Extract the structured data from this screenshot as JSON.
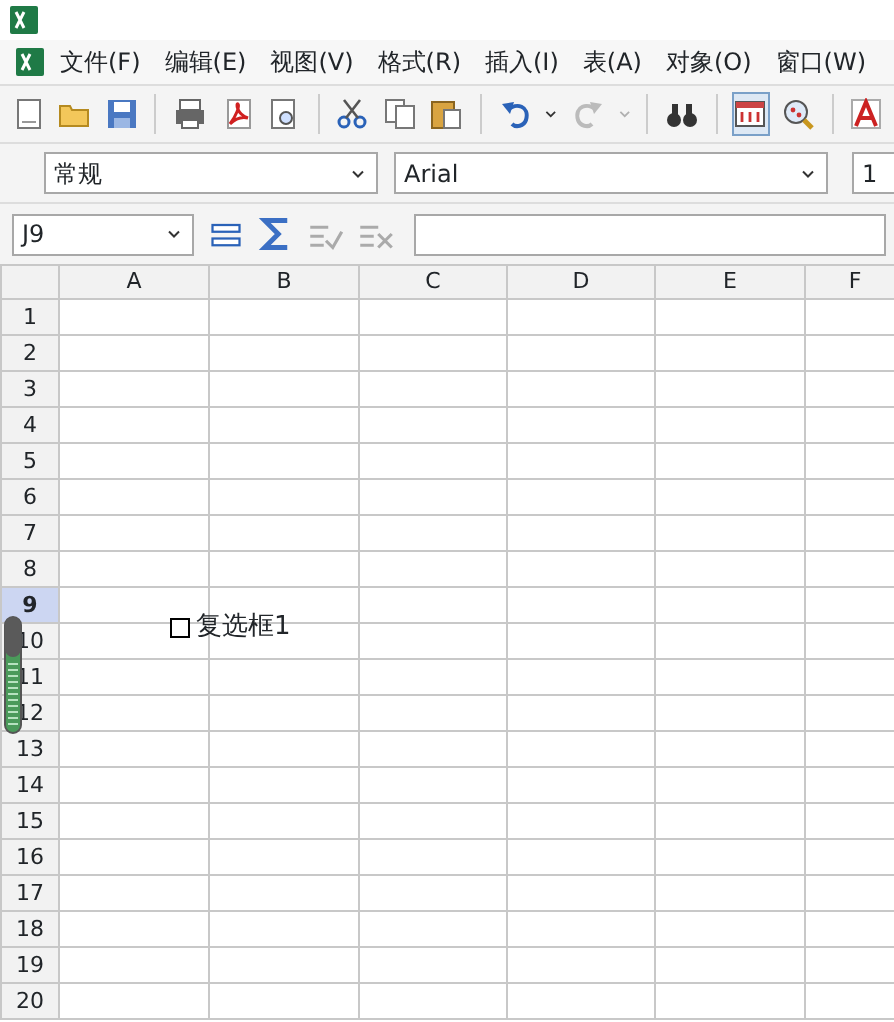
{
  "menu": [
    "文件(F)",
    "编辑(E)",
    "视图(V)",
    "格式(R)",
    "插入(I)",
    "表(A)",
    "对象(O)",
    "窗口(W)"
  ],
  "format_bar": {
    "style": "常规",
    "font": "Arial",
    "size": "1"
  },
  "formula_bar": {
    "cell_ref": "J9"
  },
  "sheet": {
    "columns": [
      "A",
      "B",
      "C",
      "D",
      "E",
      "F"
    ],
    "rows": [
      {
        "label": "1",
        "selected": false
      },
      {
        "label": "2",
        "selected": false
      },
      {
        "label": "3",
        "selected": false
      },
      {
        "label": "4",
        "selected": false
      },
      {
        "label": "5",
        "selected": false
      },
      {
        "label": "6",
        "selected": false
      },
      {
        "label": "7",
        "selected": false
      },
      {
        "label": "8",
        "selected": false
      },
      {
        "label": "9",
        "selected": true
      },
      {
        "label": "10",
        "selected": false
      },
      {
        "label": "11",
        "selected": false
      },
      {
        "label": "12",
        "selected": false
      },
      {
        "label": "13",
        "selected": false
      },
      {
        "label": "14",
        "selected": false
      },
      {
        "label": "15",
        "selected": false
      },
      {
        "label": "16",
        "selected": false
      },
      {
        "label": "17",
        "selected": false
      },
      {
        "label": "18",
        "selected": false
      },
      {
        "label": "19",
        "selected": false
      },
      {
        "label": "20",
        "selected": false
      }
    ],
    "checkbox": {
      "label": "复选框1",
      "checked": false
    }
  }
}
